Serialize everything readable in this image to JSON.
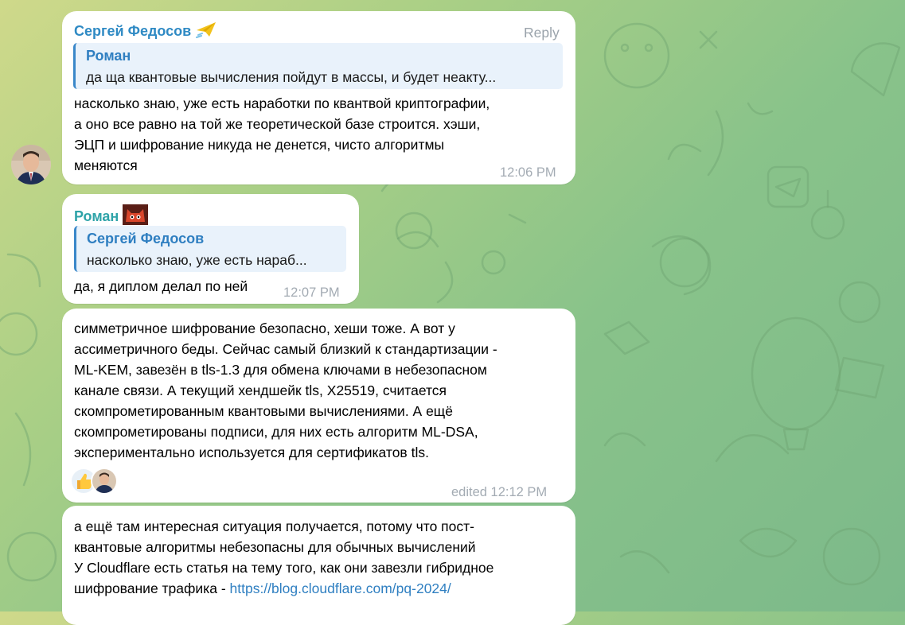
{
  "colors": {
    "sender_fedosov": "#2f8ac4",
    "sender_roman": "#2ea3a8",
    "link": "#2f7fc1",
    "timestamp": "#a3abb3"
  },
  "messages": [
    {
      "sender": "Сергей Федосов",
      "sender_badge": "paper-plane-icon",
      "reply_label": "Reply",
      "quote": {
        "name": "Роман",
        "text": "да ща квантовые вычисления пойдут в массы, и будет неакту..."
      },
      "lines": [
        "насколько знаю, уже есть наработки по квантвой криптографии,",
        "а оно все равно на той же теоретической базе строится. хэши,",
        "ЭЦП и шифрование никуда не денется, чисто алгоритмы",
        "меняются"
      ],
      "time": "12:06 PM"
    },
    {
      "sender": "Роман",
      "sender_badge": "red-cat-face-icon",
      "quote": {
        "name": "Сергей Федосов",
        "text": "насколько знаю, уже есть нараб..."
      },
      "lines": [
        "да, я диплом делал по ней"
      ],
      "time": "12:07 PM"
    },
    {
      "lines": [
        "симметричное шифрование безопасно, хеши тоже. А вот у",
        "ассиметричного беды. Сейчас самый близкий к стандартизации -",
        "ML-KEM, завезён в tls-1.3 для обмена ключами в небезопасном",
        "канале связи. А текущий хендшейк tls, X25519, считается",
        "скомпрометированным квантовыми вычислениями. А ещё",
        "скомпрометированы подписи, для них есть алгоритм ML-DSA,",
        "экспериментально используется для сертификатов tls."
      ],
      "reactions": [
        "thumbs-up-icon",
        "user-avatar"
      ],
      "time": "edited 12:12 PM"
    },
    {
      "lines": [
        "а ещё там интересная ситуация получается, потому что пост-",
        "квантовые алгоритмы небезопасны для обычных вычислений",
        "У Cloudflare есть статья на тему того, как они завезли гибридное"
      ],
      "last_line_prefix": "шифрование трафика - ",
      "link": "https://blog.cloudflare.com/pq-2024/"
    }
  ]
}
